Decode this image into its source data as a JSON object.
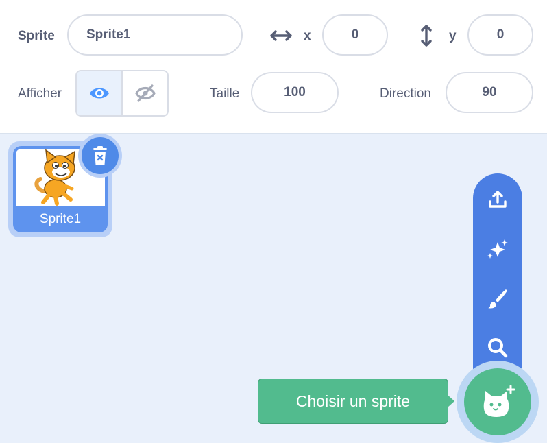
{
  "sprite_info": {
    "sprite_label": "Sprite",
    "sprite_name": "Sprite1",
    "x_label": "x",
    "x_value": "0",
    "y_label": "y",
    "y_value": "0",
    "show_label": "Afficher",
    "size_label": "Taille",
    "size_value": "100",
    "direction_label": "Direction",
    "direction_value": "90"
  },
  "sprite_list": [
    {
      "name": "Sprite1",
      "selected": true
    }
  ],
  "sprite_menu": {
    "items": [
      "upload-icon",
      "surprise-icon",
      "paint-icon",
      "search-icon"
    ],
    "tooltip": "Choisir un sprite"
  },
  "colors": {
    "accent_blue": "#4c97ff",
    "menu_blue": "#4b7ee3",
    "add_green": "#52bb8e",
    "text_gray": "#575e75"
  }
}
